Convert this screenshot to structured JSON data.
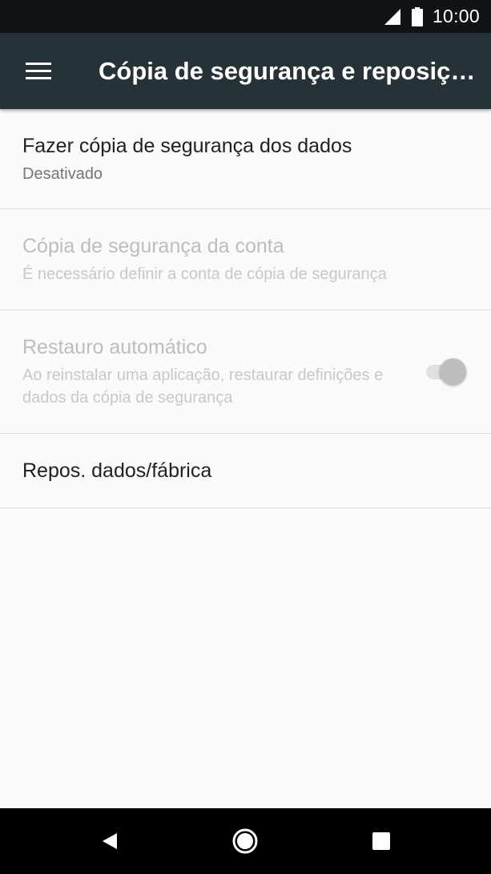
{
  "status_bar": {
    "time": "10:00",
    "signal_icon": "cell-signal-icon",
    "battery_icon": "battery-icon"
  },
  "app_bar": {
    "menu_icon": "menu-icon",
    "title": "Cópia de segurança e reposiç…"
  },
  "preferences": [
    {
      "title": "Fazer cópia de segurança dos dados",
      "summary": "Desativado",
      "enabled": true
    },
    {
      "title": "Cópia de segurança da conta",
      "summary": "É necessário definir a conta de cópia de segurança",
      "enabled": false
    },
    {
      "title": "Restauro automático",
      "summary": "Ao reinstalar uma aplicação, restaurar definições e dados da cópia de segurança",
      "enabled": false,
      "switch_on": true
    },
    {
      "title": "Repos. dados/fábrica",
      "enabled": true
    }
  ],
  "nav_bar": {
    "back_icon": "back-icon",
    "home_icon": "home-icon",
    "recents_icon": "recents-icon"
  },
  "colors": {
    "status_bar": "#111417",
    "app_bar": "#263238",
    "background": "#fafafa",
    "text_primary": "#212121",
    "text_disabled": "#bdbdbd",
    "nav_bar": "#000000"
  }
}
